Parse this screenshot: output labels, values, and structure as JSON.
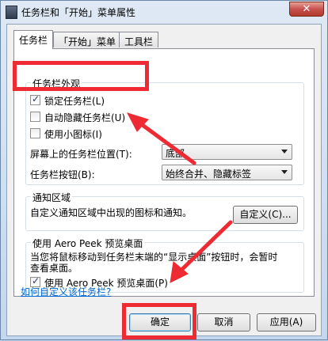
{
  "window": {
    "title": "任务栏和「开始」菜单属性",
    "close_label": "✕"
  },
  "tabs": [
    {
      "label": "任务栏",
      "active": true
    },
    {
      "label": "「开始」菜单",
      "active": false
    },
    {
      "label": "工具栏",
      "active": false
    }
  ],
  "appearance": {
    "group_label": "任务栏外观",
    "lock": {
      "label": "锁定任务栏(L)",
      "checked": true
    },
    "autohide": {
      "label": "自动隐藏任务栏(U)",
      "checked": false
    },
    "small_icons": {
      "label": "使用小图标(I)",
      "checked": false
    },
    "location": {
      "label": "屏幕上的任务栏位置(T):",
      "value": "底部"
    },
    "buttons": {
      "label": "任务栏按钮(B):",
      "value": "始终合并、隐藏标签"
    }
  },
  "notification": {
    "group_label": "通知区域",
    "description": "自定义通知区域中出现的图标和通知。",
    "customize_button": "自定义(C)..."
  },
  "aero_peek": {
    "group_label": "使用 Aero Peek 预览桌面",
    "description_line1": "当您将鼠标移动到任务栏末端的“显示桌面”按钮时，会暂时",
    "description_line2": "查看桌面。",
    "checkbox": {
      "label": "使用 Aero Peek 预览桌面(P)",
      "checked": true
    }
  },
  "help_link": "如何自定义该任务栏?",
  "footer": {
    "ok": "确定",
    "cancel": "取消",
    "apply": "应用(A)"
  },
  "annotation_color": "#ee2a32"
}
